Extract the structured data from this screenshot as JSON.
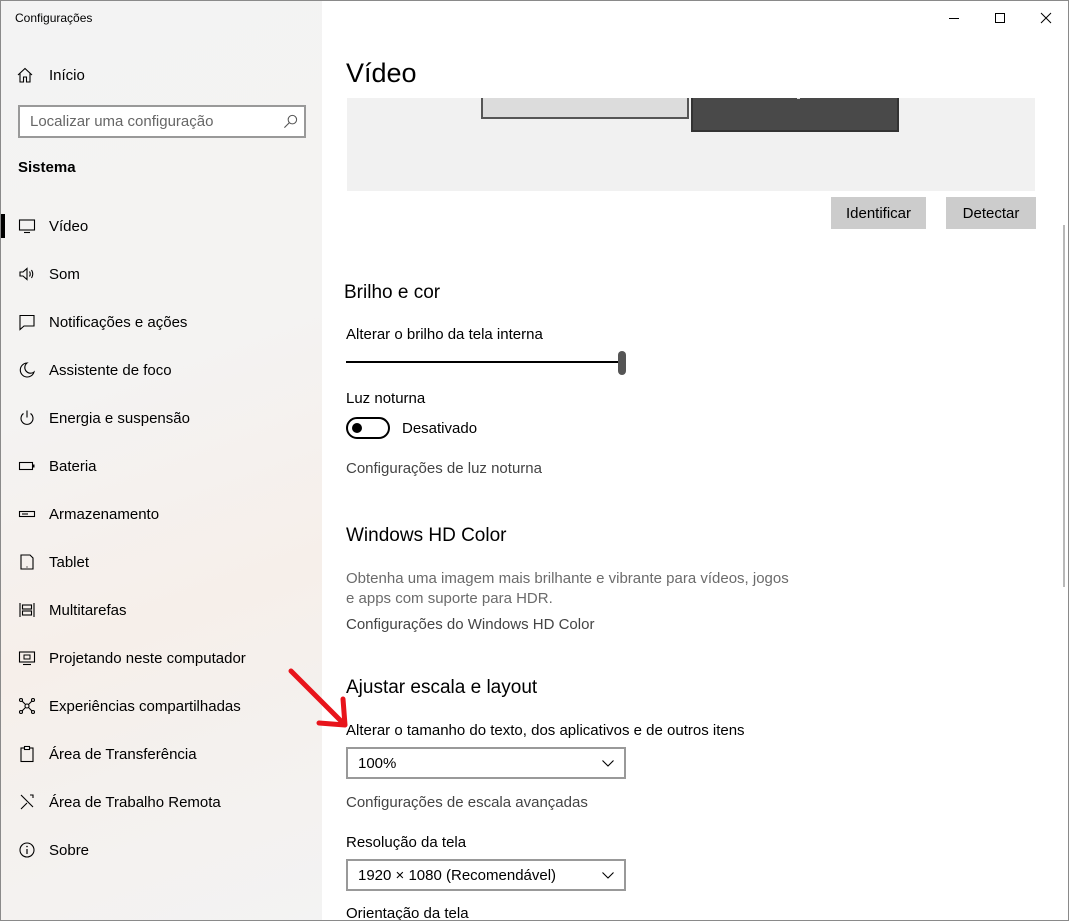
{
  "window": {
    "title": "Configurações"
  },
  "sidebar": {
    "home_label": "Início",
    "search_placeholder": "Localizar uma configuração",
    "section_title": "Sistema",
    "items": [
      {
        "label": "Vídeo",
        "icon": "monitor-icon",
        "active": true
      },
      {
        "label": "Som",
        "icon": "speaker-icon"
      },
      {
        "label": "Notificações e ações",
        "icon": "notification-icon"
      },
      {
        "label": "Assistente de foco",
        "icon": "moon-icon"
      },
      {
        "label": "Energia e suspensão",
        "icon": "power-icon"
      },
      {
        "label": "Bateria",
        "icon": "battery-icon"
      },
      {
        "label": "Armazenamento",
        "icon": "storage-icon"
      },
      {
        "label": "Tablet",
        "icon": "tablet-icon"
      },
      {
        "label": "Multitarefas",
        "icon": "multitasking-icon"
      },
      {
        "label": "Projetando neste computador",
        "icon": "projecting-icon"
      },
      {
        "label": "Experiências compartilhadas",
        "icon": "shared-experiences-icon"
      },
      {
        "label": "Área de Transferência",
        "icon": "clipboard-icon"
      },
      {
        "label": "Área de Trabalho Remota",
        "icon": "remote-desktop-icon"
      },
      {
        "label": "Sobre",
        "icon": "info-icon"
      }
    ]
  },
  "main": {
    "title": "Vídeo",
    "buttons": {
      "identify": "Identificar",
      "detect": "Detectar"
    },
    "brightness": {
      "heading": "Brilho e cor",
      "slider_label": "Alterar o brilho da tela interna",
      "brightness_value": 100,
      "night_light_label": "Luz noturna",
      "night_light_state": "Desativado",
      "night_light_link": "Configurações de luz noturna"
    },
    "hdr": {
      "heading": "Windows HD Color",
      "description_line1": "Obtenha uma imagem mais brilhante e vibrante para vídeos, jogos",
      "description_line2": "e apps com suporte para HDR.",
      "link": "Configurações do Windows HD Color"
    },
    "scale": {
      "heading": "Ajustar escala e layout",
      "size_label": "Alterar o tamanho do texto, dos aplicativos e de outros itens",
      "size_value": "100%",
      "advanced_link": "Configurações de escala avançadas",
      "resolution_label": "Resolução da tela",
      "resolution_value": "1920 × 1080 (Recomendável)",
      "orientation_label": "Orientação da tela"
    }
  },
  "colors": {
    "annotation_arrow": "#e8141b",
    "button_bg": "#cccccc"
  }
}
